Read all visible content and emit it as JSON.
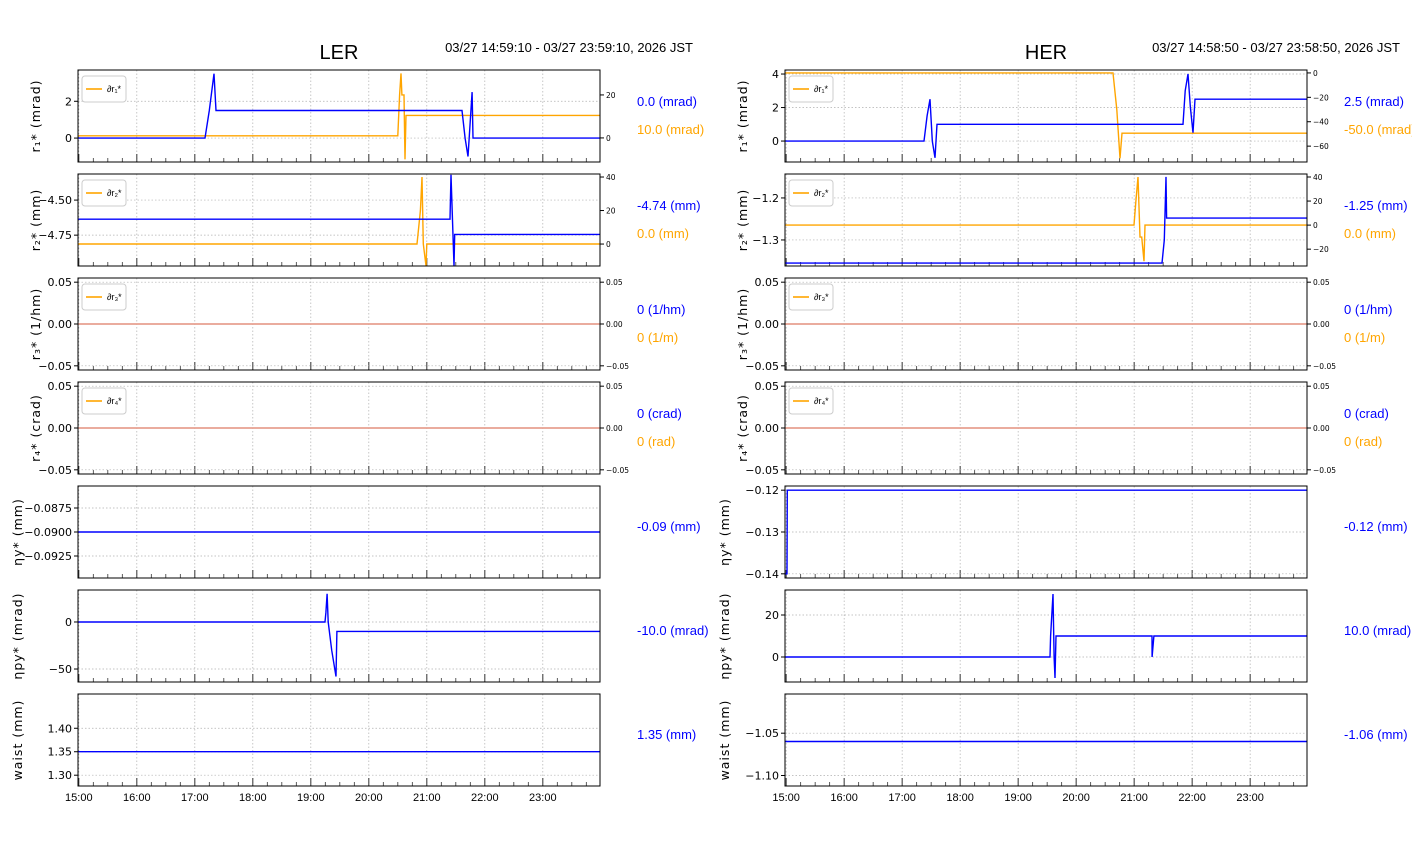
{
  "chart_data": [
    {
      "type": "line",
      "title": "LER",
      "time_range": "03/27 14:59:10 - 03/27 23:59:10, 2026 JST",
      "xlim": [
        14.986,
        23.986
      ],
      "x_ticks": [
        15,
        16,
        17,
        18,
        19,
        20,
        21,
        22,
        23
      ],
      "x_tick_labels": [
        "15:00",
        "16:00",
        "17:00",
        "18:00",
        "19:00",
        "20:00",
        "21:00",
        "22:00",
        "23:00"
      ],
      "panels": [
        {
          "ylabel": "r₁* (mrad)",
          "ylim": [
            -1.3,
            3.7
          ],
          "yticks": [
            0,
            2
          ],
          "ytick_labels": [
            "0",
            "2"
          ],
          "blue": [
            [
              14.986,
              0
            ],
            [
              17.176,
              0
            ],
            [
              17.25,
              1.5
            ],
            [
              17.33,
              3.5
            ],
            [
              17.365,
              1.5
            ],
            [
              21.607,
              1.5
            ],
            [
              21.66,
              0
            ],
            [
              21.71,
              -1
            ],
            [
              21.78,
              2.5
            ],
            [
              21.797,
              0
            ],
            [
              23.986,
              0
            ]
          ],
          "right": {
            "ylim": [
              -11.2,
              31.6
            ],
            "yticks": [
              0,
              20
            ],
            "ytick_labels": [
              "0",
              "20"
            ],
            "legend": "∂r₁*",
            "orange": [
              [
                14.986,
                1
              ],
              [
                20.5,
                1
              ],
              [
                20.53,
                20
              ],
              [
                20.555,
                30
              ],
              [
                20.57,
                20
              ],
              [
                20.607,
                20
              ],
              [
                20.624,
                -10
              ],
              [
                20.641,
                10.5
              ],
              [
                23.986,
                10.5
              ]
            ]
          },
          "value_blue": "0.0 (mrad)",
          "value_orange": "10.0 (mrad)"
        },
        {
          "ylabel": "r₂* (mm)",
          "ylim": [
            -4.97,
            -4.314
          ],
          "yticks": [
            -4.5,
            -4.75
          ],
          "ytick_labels": [
            "−4.50",
            "−4.75"
          ],
          "blue": [
            [
              14.986,
              -4.636
            ],
            [
              21.4,
              -4.636
            ],
            [
              21.417,
              -4.32
            ],
            [
              21.44,
              -4.6
            ],
            [
              21.469,
              -4.97
            ],
            [
              21.48,
              -4.745
            ],
            [
              23.986,
              -4.745
            ]
          ],
          "right": {
            "ylim": [
              -13.1,
              41.8
            ],
            "yticks": [
              0,
              20,
              40
            ],
            "ytick_labels": [
              "0",
              "20",
              "40"
            ],
            "legend": "∂r₂*",
            "orange": [
              [
                14.986,
                0
              ],
              [
                20.83,
                0
              ],
              [
                20.86,
                10
              ],
              [
                20.89,
                20
              ],
              [
                20.917,
                40
              ],
              [
                20.94,
                0
              ],
              [
                20.986,
                -13
              ],
              [
                21.0,
                0
              ],
              [
                23.986,
                0
              ]
            ]
          },
          "value_blue": "-4.74 (mm)",
          "value_orange": "0.0 (mm)"
        },
        {
          "ylabel": "r₃* (1/hm)",
          "ylim": [
            -0.055,
            0.055
          ],
          "yticks": [
            0.05,
            0,
            -0.05
          ],
          "ytick_labels": [
            "0.05",
            "0.00",
            "−0.05"
          ],
          "blue": [
            [
              14.986,
              0
            ],
            [
              23.986,
              0
            ]
          ],
          "right": {
            "ylim": [
              -0.055,
              0.055
            ],
            "yticks": [
              0.05,
              0,
              -0.05
            ],
            "ytick_labels": [
              "0.05",
              "0.00",
              "−0.05"
            ],
            "legend": "∂r₃*",
            "orange": [
              [
                14.986,
                0
              ],
              [
                23.986,
                0
              ]
            ]
          },
          "value_blue": "0 (1/hm)",
          "value_orange": "0 (1/m)"
        },
        {
          "ylabel": "r₄* (crad)",
          "ylim": [
            -0.055,
            0.055
          ],
          "yticks": [
            0.05,
            0,
            -0.05
          ],
          "ytick_labels": [
            "0.05",
            "0.00",
            "−0.05"
          ],
          "blue": [
            [
              14.986,
              0
            ],
            [
              23.986,
              0
            ]
          ],
          "right": {
            "ylim": [
              -0.055,
              0.055
            ],
            "yticks": [
              0.05,
              0,
              -0.05
            ],
            "ytick_labels": [
              "0.05",
              "0.00",
              "−0.05"
            ],
            "legend": "∂r₄*",
            "orange": [
              [
                14.986,
                0
              ],
              [
                23.986,
                0
              ]
            ]
          },
          "value_blue": "0 (crad)",
          "value_orange": "0 (rad)"
        },
        {
          "ylabel": "ηy* (mm)",
          "ylim": [
            -0.09479,
            -0.08521
          ],
          "yticks": [
            -0.0875,
            -0.09,
            -0.0925
          ],
          "ytick_labels": [
            "−0.0875",
            "−0.0900",
            "−0.0925"
          ],
          "blue": [
            [
              14.986,
              -0.09
            ],
            [
              23.986,
              -0.09
            ]
          ],
          "value_blue": "-0.09 (mm)"
        },
        {
          "ylabel": "ηpy* (mrad)",
          "ylim": [
            -63.8,
            34
          ],
          "yticks": [
            0,
            -50
          ],
          "ytick_labels": [
            "0",
            "−50"
          ],
          "blue": [
            [
              14.986,
              0
            ],
            [
              19.245,
              0
            ],
            [
              19.26,
              10
            ],
            [
              19.28,
              30
            ],
            [
              19.3,
              0
            ],
            [
              19.36,
              -30
            ],
            [
              19.434,
              -58
            ],
            [
              19.45,
              -10
            ],
            [
              23.986,
              -10
            ]
          ],
          "value_blue": "-10.0 (mrad)"
        },
        {
          "ylabel": "waist (mm)",
          "ylim": [
            1.277,
            1.473
          ],
          "yticks": [
            1.4,
            1.35,
            1.3
          ],
          "ytick_labels": [
            "1.40",
            "1.35",
            "1.30"
          ],
          "blue": [
            [
              14.986,
              1.35
            ],
            [
              23.986,
              1.35
            ]
          ],
          "value_blue": "1.35 (mm)"
        }
      ]
    },
    {
      "type": "line",
      "title": "HER",
      "time_range": "03/27 14:58:50 - 03/27 23:58:50, 2026 JST",
      "xlim": [
        14.98,
        23.98
      ],
      "x_ticks": [
        15,
        16,
        17,
        18,
        19,
        20,
        21,
        22,
        23
      ],
      "x_tick_labels": [
        "15:00",
        "16:00",
        "17:00",
        "18:00",
        "19:00",
        "20:00",
        "21:00",
        "22:00",
        "23:00"
      ],
      "panels": [
        {
          "ylabel": "r₁* (mrad)",
          "ylim": [
            -1.25,
            4.24
          ],
          "yticks": [
            0,
            2,
            4
          ],
          "ytick_labels": [
            "0",
            "2",
            "4"
          ],
          "blue": [
            [
              14.98,
              0
            ],
            [
              17.377,
              0
            ],
            [
              17.43,
              1.5
            ],
            [
              17.48,
              2.5
            ],
            [
              17.52,
              0
            ],
            [
              17.566,
              -1
            ],
            [
              17.6,
              1
            ],
            [
              21.842,
              1
            ],
            [
              21.88,
              3
            ],
            [
              21.928,
              4
            ],
            [
              21.97,
              2
            ],
            [
              22.014,
              0.5
            ],
            [
              22.049,
              2.5
            ],
            [
              23.98,
              2.5
            ]
          ],
          "right": {
            "ylim": [
              -73,
              2.4
            ],
            "yticks": [
              0,
              -20,
              -40,
              -60
            ],
            "ytick_labels": [
              "0",
              "−20",
              "−40",
              "−60"
            ],
            "legend": "∂r₁*",
            "orange": [
              [
                14.98,
                0
              ],
              [
                20.635,
                0
              ],
              [
                20.7,
                -30
              ],
              [
                20.756,
                -70
              ],
              [
                20.79,
                -49.4
              ],
              [
                23.98,
                -49.4
              ]
            ]
          },
          "value_blue": "2.5 (mrad)",
          "value_orange": "-50.0 (mrad)"
        },
        {
          "ylabel": "r₂* (mm)",
          "ylim": [
            -1.362,
            -1.143
          ],
          "yticks": [
            -1.2,
            -1.3
          ],
          "ytick_labels": [
            "−1.2",
            "−1.3"
          ],
          "blue": [
            [
              14.98,
              -1.355
            ],
            [
              21.48,
              -1.355
            ],
            [
              21.52,
              -1.3
            ],
            [
              21.549,
              -1.15
            ],
            [
              21.56,
              -1.248
            ],
            [
              23.98,
              -1.248
            ]
          ],
          "right": {
            "ylim": [
              -34,
              42.5
            ],
            "yticks": [
              40,
              20,
              0,
              -20
            ],
            "ytick_labels": [
              "40",
              "20",
              "0",
              "−20"
            ],
            "legend": "∂r₂*",
            "orange": [
              [
                14.98,
                0
              ],
              [
                20.997,
                0
              ],
              [
                21.03,
                20
              ],
              [
                21.066,
                40
              ],
              [
                21.1,
                -10
              ],
              [
                21.13,
                -10
              ],
              [
                21.17,
                -30
              ],
              [
                21.187,
                0
              ],
              [
                23.98,
                0
              ]
            ]
          },
          "value_blue": "-1.25 (mm)",
          "value_orange": "0.0 (mm)"
        },
        {
          "ylabel": "r₃* (1/hm)",
          "ylim": [
            -0.055,
            0.055
          ],
          "yticks": [
            0.05,
            0,
            -0.05
          ],
          "ytick_labels": [
            "0.05",
            "0.00",
            "−0.05"
          ],
          "blue": [
            [
              14.98,
              0
            ],
            [
              23.98,
              0
            ]
          ],
          "right": {
            "ylim": [
              -0.055,
              0.055
            ],
            "yticks": [
              0.05,
              0,
              -0.05
            ],
            "ytick_labels": [
              "0.05",
              "0.00",
              "−0.05"
            ],
            "legend": "∂r₃*",
            "orange": [
              [
                14.98,
                0
              ],
              [
                23.98,
                0
              ]
            ]
          },
          "value_blue": "0 (1/hm)",
          "value_orange": "0 (1/m)"
        },
        {
          "ylabel": "r₄* (crad)",
          "ylim": [
            -0.055,
            0.055
          ],
          "yticks": [
            0.05,
            0,
            -0.05
          ],
          "ytick_labels": [
            "0.05",
            "0.00",
            "−0.05"
          ],
          "blue": [
            [
              14.98,
              0
            ],
            [
              23.98,
              0
            ]
          ],
          "right": {
            "ylim": [
              -0.055,
              0.055
            ],
            "yticks": [
              0.05,
              0,
              -0.05
            ],
            "ytick_labels": [
              "0.05",
              "0.00",
              "−0.05"
            ],
            "legend": "∂r₄*",
            "orange": [
              [
                14.98,
                0
              ],
              [
                23.98,
                0
              ]
            ]
          },
          "value_blue": "0 (crad)",
          "value_orange": "0 (rad)"
        },
        {
          "ylabel": "ηy* (mm)",
          "ylim": [
            -0.141,
            -0.119
          ],
          "yticks": [
            -0.12,
            -0.13,
            -0.14
          ],
          "ytick_labels": [
            "−0.12",
            "−0.13",
            "−0.14"
          ],
          "blue": [
            [
              14.98,
              -0.14
            ],
            [
              15.014,
              -0.14
            ],
            [
              15.02,
              -0.12
            ],
            [
              23.98,
              -0.12
            ]
          ],
          "value_blue": "-0.12 (mm)"
        },
        {
          "ylabel": "ηpy* (mrad)",
          "ylim": [
            -11.9,
            31.9
          ],
          "yticks": [
            20,
            0
          ],
          "ytick_labels": [
            "20",
            "0"
          ],
          "blue": [
            [
              14.98,
              0
            ],
            [
              19.549,
              0
            ],
            [
              19.56,
              10
            ],
            [
              19.6,
              30
            ],
            [
              19.62,
              0
            ],
            [
              19.635,
              -10
            ],
            [
              19.652,
              10
            ],
            [
              21.308,
              10
            ],
            [
              21.31,
              0
            ],
            [
              21.34,
              10
            ],
            [
              23.98,
              10
            ]
          ],
          "value_blue": "10.0 (mrad)"
        },
        {
          "ylabel": "waist (mm)",
          "ylim": [
            -1.1124,
            -1.0037
          ],
          "yticks": [
            -1.05,
            -1.1
          ],
          "ytick_labels": [
            "−1.05",
            "−1.10"
          ],
          "blue": [
            [
              14.98,
              -1.0598
            ],
            [
              23.98,
              -1.0598
            ]
          ],
          "value_blue": "-1.06 (mm)"
        }
      ]
    }
  ],
  "colors": {
    "blue": "#0000ff",
    "orange": "#ffa500",
    "overlap": "#e8a090",
    "grid": "#b0b0b0"
  }
}
